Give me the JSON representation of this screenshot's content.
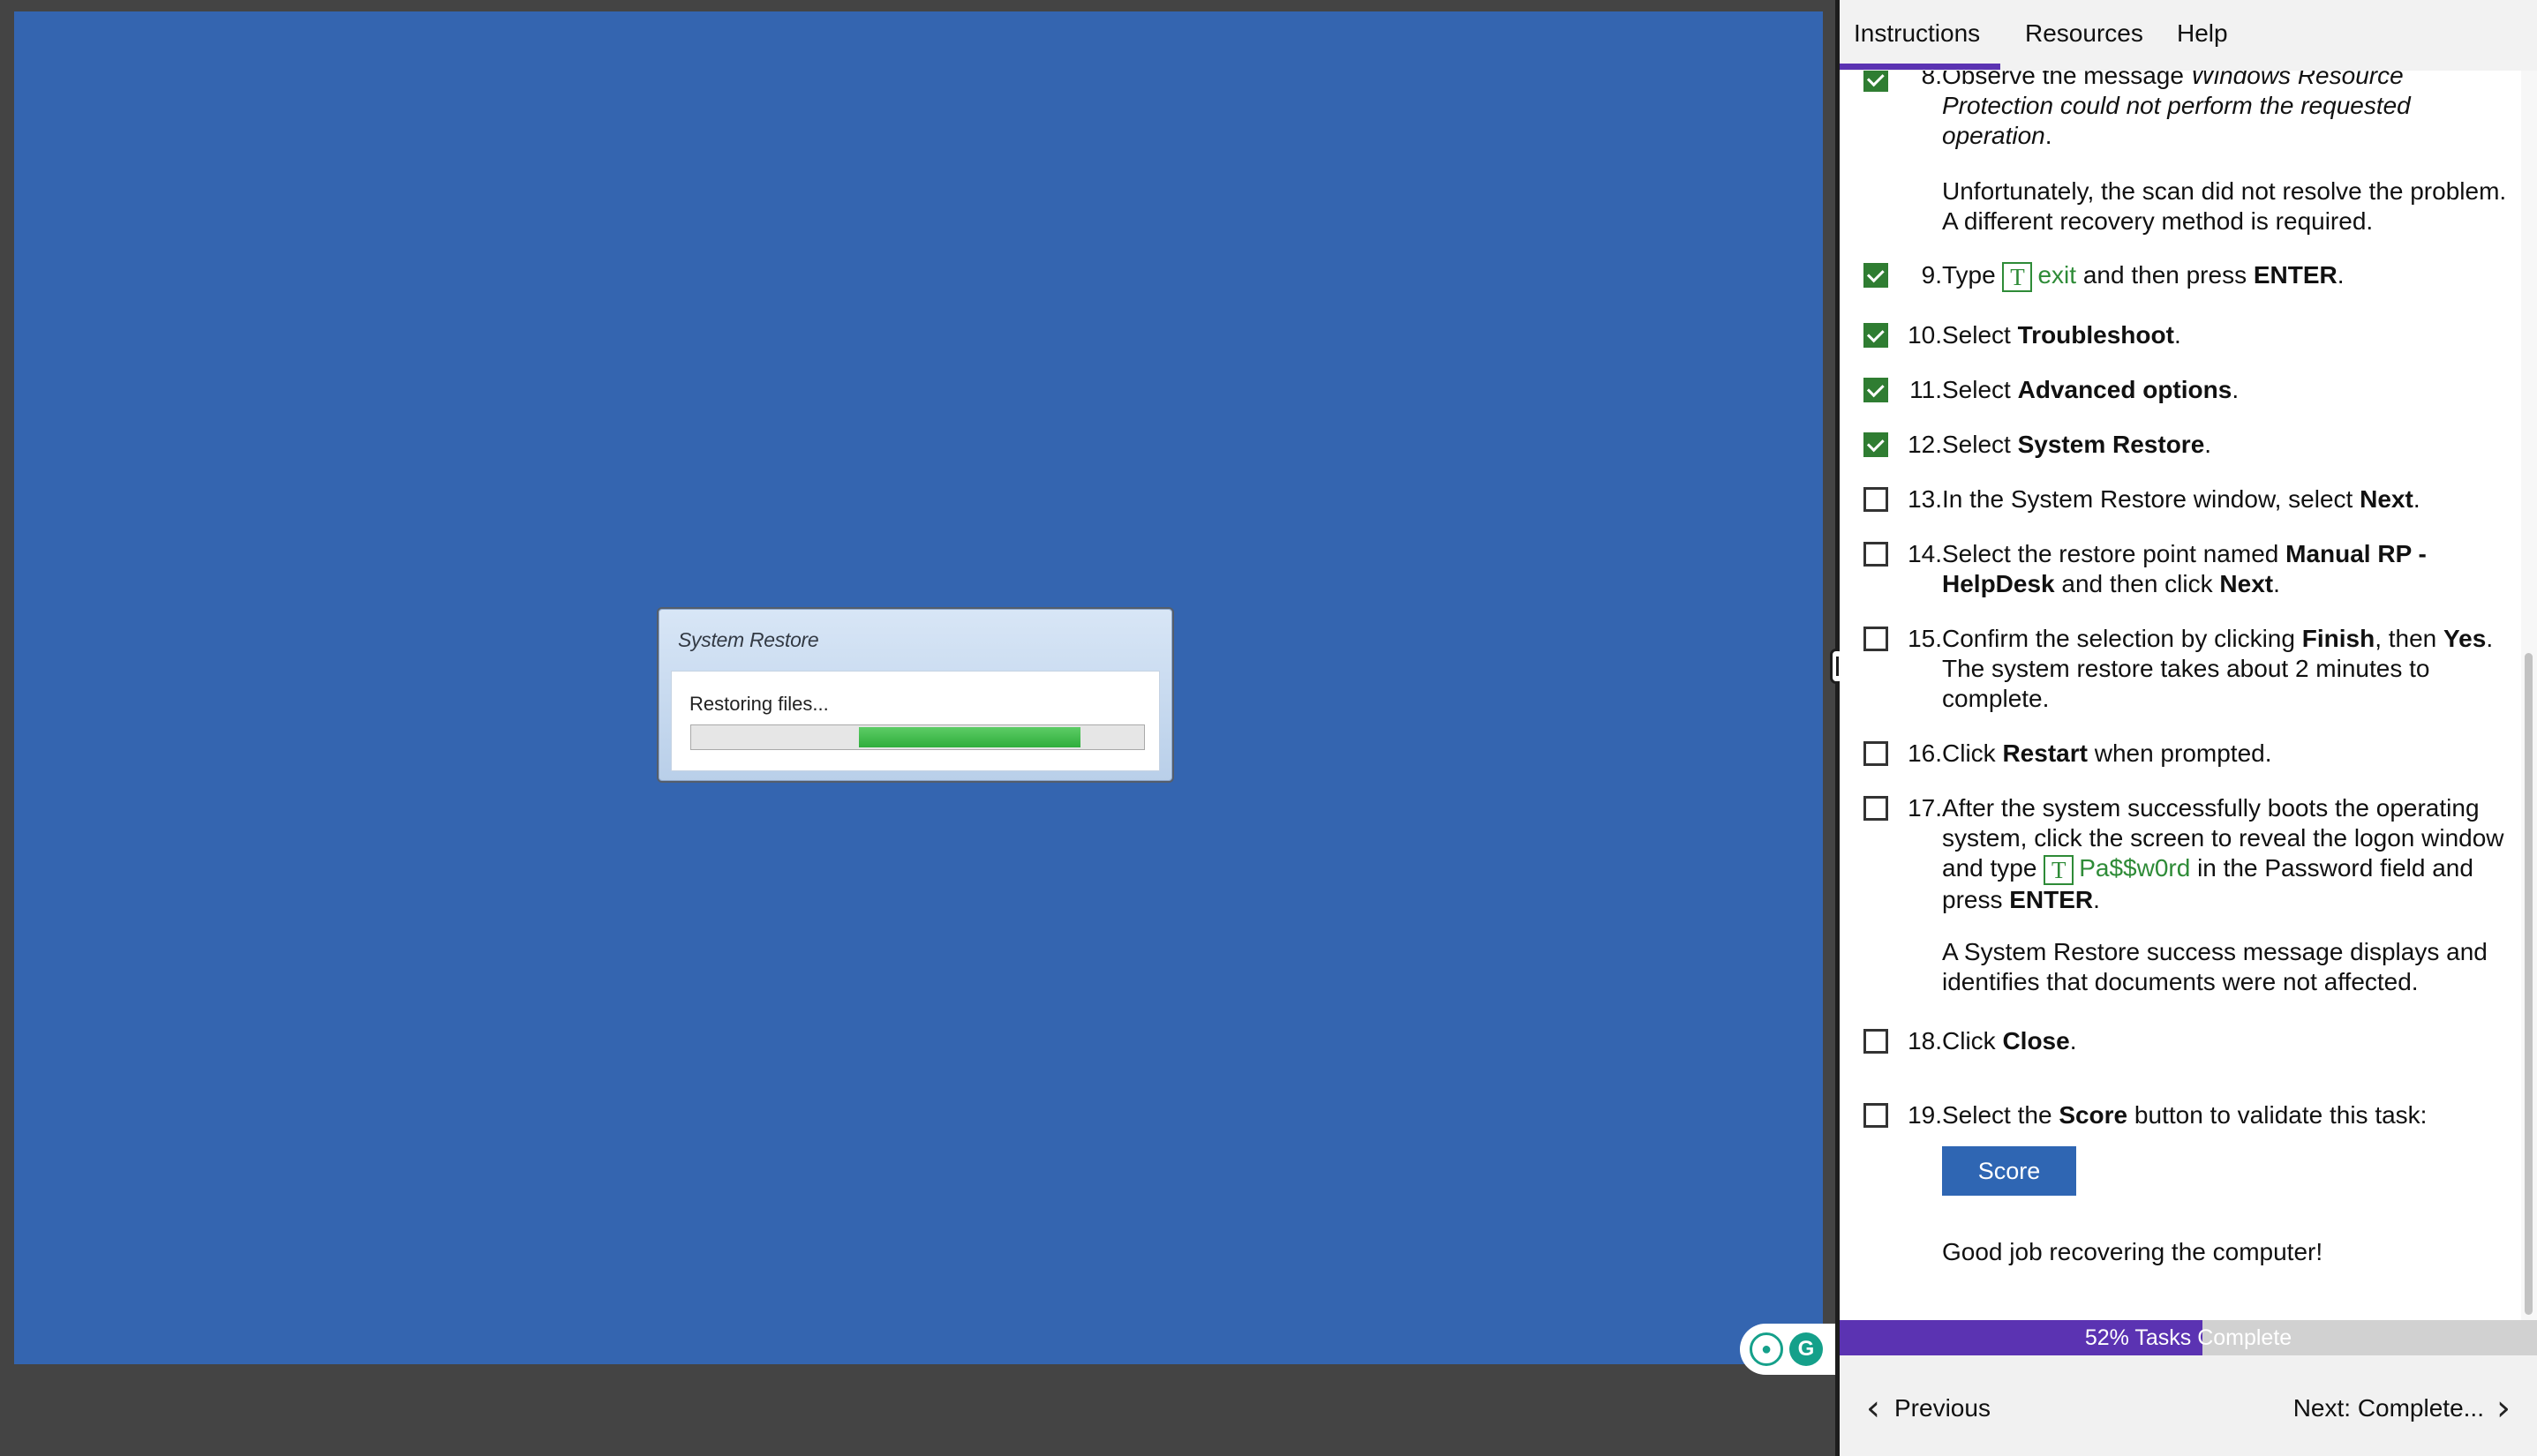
{
  "vm": {
    "dialog_title": "System Restore",
    "dialog_message": "Restoring files...",
    "progress_segment": {
      "start_fraction": 0.37,
      "end_fraction": 0.86
    }
  },
  "tabs": [
    "Instructions",
    "Resources",
    "Help"
  ],
  "active_tab": "Instructions",
  "steps": {
    "s8": {
      "num": "8.",
      "checked": true,
      "pre": "Observe the message ",
      "italic": "Windows Resource Protection could not perform the requested operation",
      "post": ".",
      "note": "Unfortunately, the scan did not resolve the problem. A different recovery method is required."
    },
    "s9": {
      "num": "9.",
      "checked": true,
      "pre": "Type ",
      "type_value": "exit",
      "post": " and then press ",
      "bold": "ENTER",
      "end": "."
    },
    "s10": {
      "num": "10.",
      "checked": true,
      "pre": "Select ",
      "bold": "Troubleshoot",
      "end": "."
    },
    "s11": {
      "num": "11.",
      "checked": true,
      "pre": "Select ",
      "bold": "Advanced options",
      "end": "."
    },
    "s12": {
      "num": "12.",
      "checked": true,
      "pre": "Select ",
      "bold": "System Restore",
      "end": "."
    },
    "s13": {
      "num": "13.",
      "checked": false,
      "pre": "In the System Restore window, select ",
      "bold": "Next",
      "end": "."
    },
    "s14": {
      "num": "14.",
      "checked": false,
      "pre": "Select the restore point named ",
      "bold": "Manual RP - HelpDesk",
      "mid": " and then click ",
      "bold2": "Next",
      "end": "."
    },
    "s15": {
      "num": "15.",
      "checked": false,
      "pre": "Confirm the selection by clicking ",
      "bold": "Finish",
      "mid": ", then ",
      "bold2": "Yes",
      "end": ". The system restore takes about 2 minutes to complete."
    },
    "s16": {
      "num": "16.",
      "checked": false,
      "pre": "Click ",
      "bold": "Restart",
      "end": " when prompted."
    },
    "s17": {
      "num": "17.",
      "checked": false,
      "pre": "After the system successfully boots the operating system, click the screen to reveal the logon window and type ",
      "type_value": "Pa$$w0rd",
      "mid": " in the Password field and press ",
      "bold": "ENTER",
      "end": ".",
      "note": "A System Restore success message displays and identifies that documents were not affected."
    },
    "s18": {
      "num": "18.",
      "checked": false,
      "pre": "Click ",
      "bold": "Close",
      "end": "."
    },
    "s19": {
      "num": "19.",
      "checked": false,
      "pre": "Select the ",
      "bold": "Score",
      "end": " button to validate this task:",
      "button": "Score",
      "note": "Good job recovering the computer!"
    }
  },
  "type_icon_glyph": "T",
  "progress": {
    "percent": 52,
    "label": "52% Tasks Complete"
  },
  "nav": {
    "previous": "Previous",
    "next": "Next: Complete...",
    "prev_chevron": "‹",
    "next_chevron": "›"
  },
  "colors": {
    "vm_background": "#3465B0",
    "accent_purple": "#5b33b2",
    "check_green": "#2f7d32",
    "score_blue": "#2f66b3"
  }
}
